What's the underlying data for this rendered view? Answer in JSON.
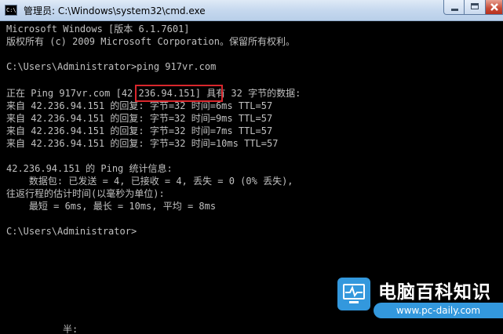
{
  "window": {
    "title": "管理员: C:\\Windows\\system32\\cmd.exe",
    "icon_text": "C:\\"
  },
  "console": {
    "lines": [
      "Microsoft Windows [版本 6.1.7601]",
      "版权所有 (c) 2009 Microsoft Corporation。保留所有权利。",
      "",
      "C:\\Users\\Administrator>ping 917vr.com",
      "",
      "正在 Ping 917vr.com [42.236.94.151] 具有 32 字节的数据:",
      "来自 42.236.94.151 的回复: 字节=32 时间=6ms TTL=57",
      "来自 42.236.94.151 的回复: 字节=32 时间=9ms TTL=57",
      "来自 42.236.94.151 的回复: 字节=32 时间=7ms TTL=57",
      "来自 42.236.94.151 的回复: 字节=32 时间=10ms TTL=57",
      "",
      "42.236.94.151 的 Ping 统计信息:",
      "    数据包: 已发送 = 4, 已接收 = 4, 丢失 = 0 (0% 丢失),",
      "往返行程的估计时间(以毫秒为单位):",
      "    最短 = 6ms, 最长 = 10ms, 平均 = 8ms",
      "",
      "C:\\Users\\Administrator>"
    ],
    "partial_text": "半:"
  },
  "watermark": {
    "title": "电脑百科知识",
    "url": "www.pc-daily.com"
  },
  "colors": {
    "console_text": "#c0c0c0",
    "highlight_border": "#d9262c",
    "watermark_blue": "#3398dd"
  }
}
